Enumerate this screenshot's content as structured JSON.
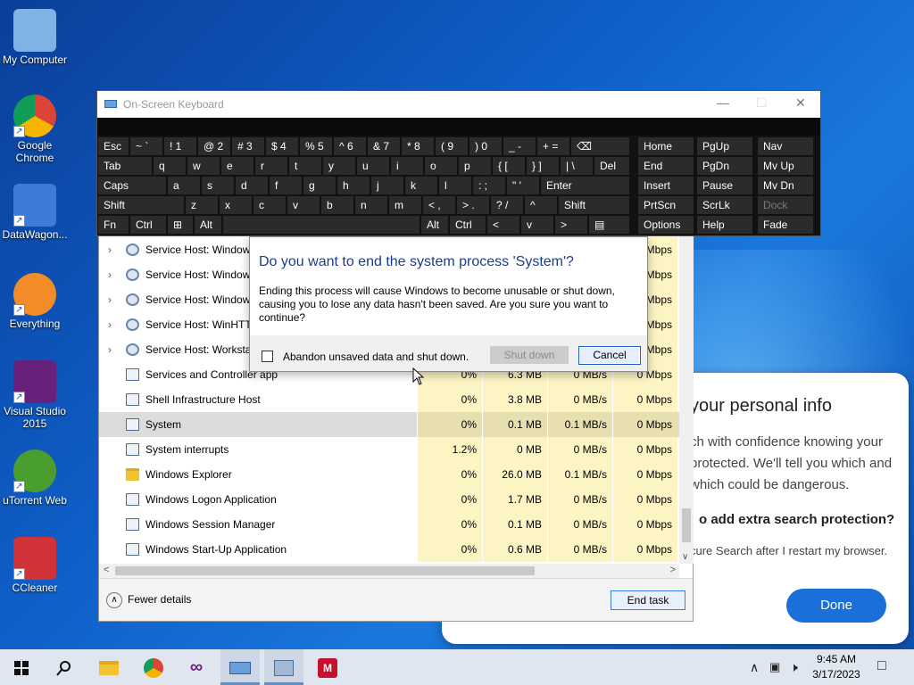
{
  "desktop_icons": [
    {
      "label": "My Computer",
      "icon": "computer-icon"
    },
    {
      "label": "Google Chrome",
      "icon": "chrome-icon"
    },
    {
      "label": "DataWagon...",
      "icon": "datawagon-icon"
    },
    {
      "label": "Everything",
      "icon": "everything-search-icon"
    },
    {
      "label": "Visual Studio 2015",
      "icon": "visual-studio-icon"
    },
    {
      "label": "uTorrent Web",
      "icon": "utorrent-icon"
    },
    {
      "label": "CCleaner",
      "icon": "ccleaner-icon"
    }
  ],
  "promo": {
    "title": "your personal info",
    "body": "ch with confidence knowing your protected. We'll tell you which and which could be dangerous.",
    "question": "o add extra search protection?",
    "sub": "cure Search after I restart my browser.",
    "done": "Done"
  },
  "osk": {
    "title": "On-Screen Keyboard",
    "rows": [
      [
        "Esc",
        "~ `",
        "! 1",
        "@ 2",
        "# 3",
        "$ 4",
        "% 5",
        "^ 6",
        "& 7",
        "* 8",
        "( 9",
        ") 0",
        "_ -",
        "+ =",
        "⌫",
        "Home",
        "PgUp",
        "Nav"
      ],
      [
        "Tab",
        "q",
        "w",
        "e",
        "r",
        "t",
        "y",
        "u",
        "i",
        "o",
        "p",
        "{ [",
        "} ]",
        "| \\",
        "Del",
        "End",
        "PgDn",
        "Mv Up"
      ],
      [
        "Caps",
        "a",
        "s",
        "d",
        "f",
        "g",
        "h",
        "j",
        "k",
        "l",
        ": ;",
        "\" '",
        "Enter",
        "Insert",
        "Pause",
        "Mv Dn"
      ],
      [
        "Shift",
        "z",
        "x",
        "c",
        "v",
        "b",
        "n",
        "m",
        "< ,",
        "> .",
        "? /",
        "^",
        "Shift",
        "PrtScn",
        "ScrLk",
        "Dock"
      ],
      [
        "Fn",
        "Ctrl",
        "⊞",
        "Alt",
        "",
        "Alt",
        "Ctrl",
        "<",
        "v",
        ">",
        "▤",
        "Options",
        "Help",
        "Fade"
      ]
    ]
  },
  "task_manager": {
    "rows": [
      {
        "name": "Service Host: Window",
        "cpu": "",
        "mem": "",
        "disk": "",
        "net": "Mbps",
        "expandable": true,
        "icon": "gear"
      },
      {
        "name": "Service Host: Window",
        "cpu": "",
        "mem": "",
        "disk": "",
        "net": "Mbps",
        "expandable": true,
        "icon": "gear"
      },
      {
        "name": "Service Host: Window",
        "cpu": "",
        "mem": "",
        "disk": "",
        "net": "Mbps",
        "expandable": true,
        "icon": "gear"
      },
      {
        "name": "Service Host: WinHTTI",
        "cpu": "",
        "mem": "",
        "disk": "",
        "net": "Mbps",
        "expandable": true,
        "icon": "gear"
      },
      {
        "name": "Service Host: Workstat",
        "cpu": "",
        "mem": "",
        "disk": "",
        "net": "Mbps",
        "expandable": true,
        "icon": "gear"
      },
      {
        "name": "Services and Controller app",
        "cpu": "0%",
        "mem": "6.3 MB",
        "disk": "0 MB/s",
        "net": "0 Mbps",
        "expandable": false,
        "icon": "app"
      },
      {
        "name": "Shell Infrastructure Host",
        "cpu": "0%",
        "mem": "3.8 MB",
        "disk": "0 MB/s",
        "net": "0 Mbps",
        "expandable": false,
        "icon": "app"
      },
      {
        "name": "System",
        "cpu": "0%",
        "mem": "0.1 MB",
        "disk": "0.1 MB/s",
        "net": "0 Mbps",
        "expandable": false,
        "icon": "app",
        "selected": true
      },
      {
        "name": "System interrupts",
        "cpu": "1.2%",
        "mem": "0 MB",
        "disk": "0 MB/s",
        "net": "0 Mbps",
        "expandable": false,
        "icon": "app"
      },
      {
        "name": "Windows Explorer",
        "cpu": "0%",
        "mem": "26.0 MB",
        "disk": "0.1 MB/s",
        "net": "0 Mbps",
        "expandable": false,
        "icon": "folder"
      },
      {
        "name": "Windows Logon Application",
        "cpu": "0%",
        "mem": "1.7 MB",
        "disk": "0 MB/s",
        "net": "0 Mbps",
        "expandable": false,
        "icon": "app"
      },
      {
        "name": "Windows Session Manager",
        "cpu": "0%",
        "mem": "0.1 MB",
        "disk": "0 MB/s",
        "net": "0 Mbps",
        "expandable": false,
        "icon": "app"
      },
      {
        "name": "Windows Start-Up Application",
        "cpu": "0%",
        "mem": "0.6 MB",
        "disk": "0 MB/s",
        "net": "0 Mbps",
        "expandable": false,
        "icon": "app"
      }
    ],
    "fewer_details": "Fewer details",
    "end_task": "End task"
  },
  "dialog": {
    "heading": "Do you want to end the system process 'System'?",
    "body": "Ending this process will cause Windows to become unusable or shut down, causing you to lose any data hasn't been saved. Are you sure you want to continue?",
    "checkbox_label": "Abandon unsaved data and shut down.",
    "shutdown": "Shut down",
    "cancel": "Cancel"
  },
  "taskbar": {
    "time": "9:45 AM",
    "date": "3/17/2023"
  },
  "colors": {
    "accent": "#1a6fd8",
    "cell_bg": "#fdf4c4",
    "osk_key": "#2b2b2b"
  }
}
